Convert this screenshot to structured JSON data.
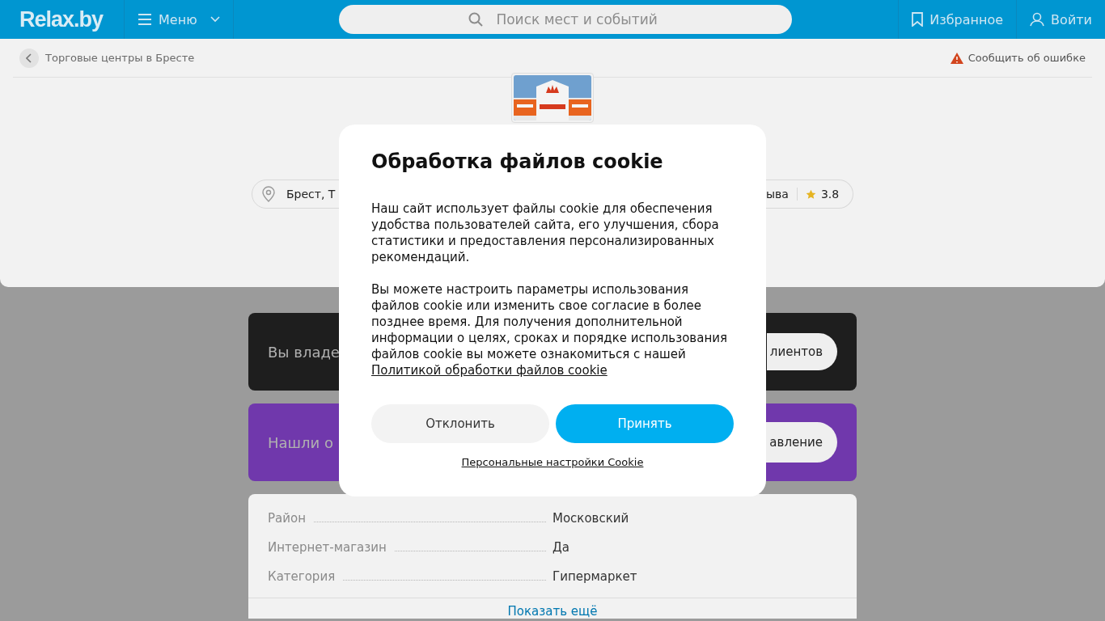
{
  "header": {
    "logo": "Relax.by",
    "menu": "Меню",
    "search": {
      "placeholder": "Поиск мест и событий"
    },
    "favorites": "Избранное",
    "login": "Войти"
  },
  "breadcrumb": {
    "back": "Торговые центры в Бресте",
    "report": "Сообщить об ошибке"
  },
  "place": {
    "address": "Брест, Т",
    "reviews": "ыва",
    "rating": "3.8"
  },
  "owner_card": {
    "text": "Вы владе",
    "button": "лиентов"
  },
  "error_card": {
    "text": "Нашли о",
    "button": "авление"
  },
  "details": {
    "rows": [
      {
        "label": "Район",
        "value": "Московский"
      },
      {
        "label": "Интернет-магазин",
        "value": "Да"
      },
      {
        "label": "Категория",
        "value": "Гипермаркет"
      }
    ],
    "more": "Показать ещё"
  },
  "cookie_dialog": {
    "title": "Обработка файлов cookie",
    "paragraphs": [
      "Наш сайт использует файлы cookie для обеспечения удобства пользователей сайта, его улучшения, сбора статистики и предоставления персонализированных рекомендаций.",
      "Вы можете настроить параметры использования файлов cookie или изменить свое согласие в более позднее время. Для получения дополнительной информации о целях, сроках и порядке использования файлов cookie вы можете ознакомиться с нашей"
    ],
    "policy_link": "Политикой обработки файлов cookie",
    "buttons": [
      {
        "label": "Отклонить",
        "kind": "secondary"
      },
      {
        "label": "Принять",
        "kind": "primary"
      }
    ],
    "settings_link": "Персональные настройки Cookie"
  }
}
